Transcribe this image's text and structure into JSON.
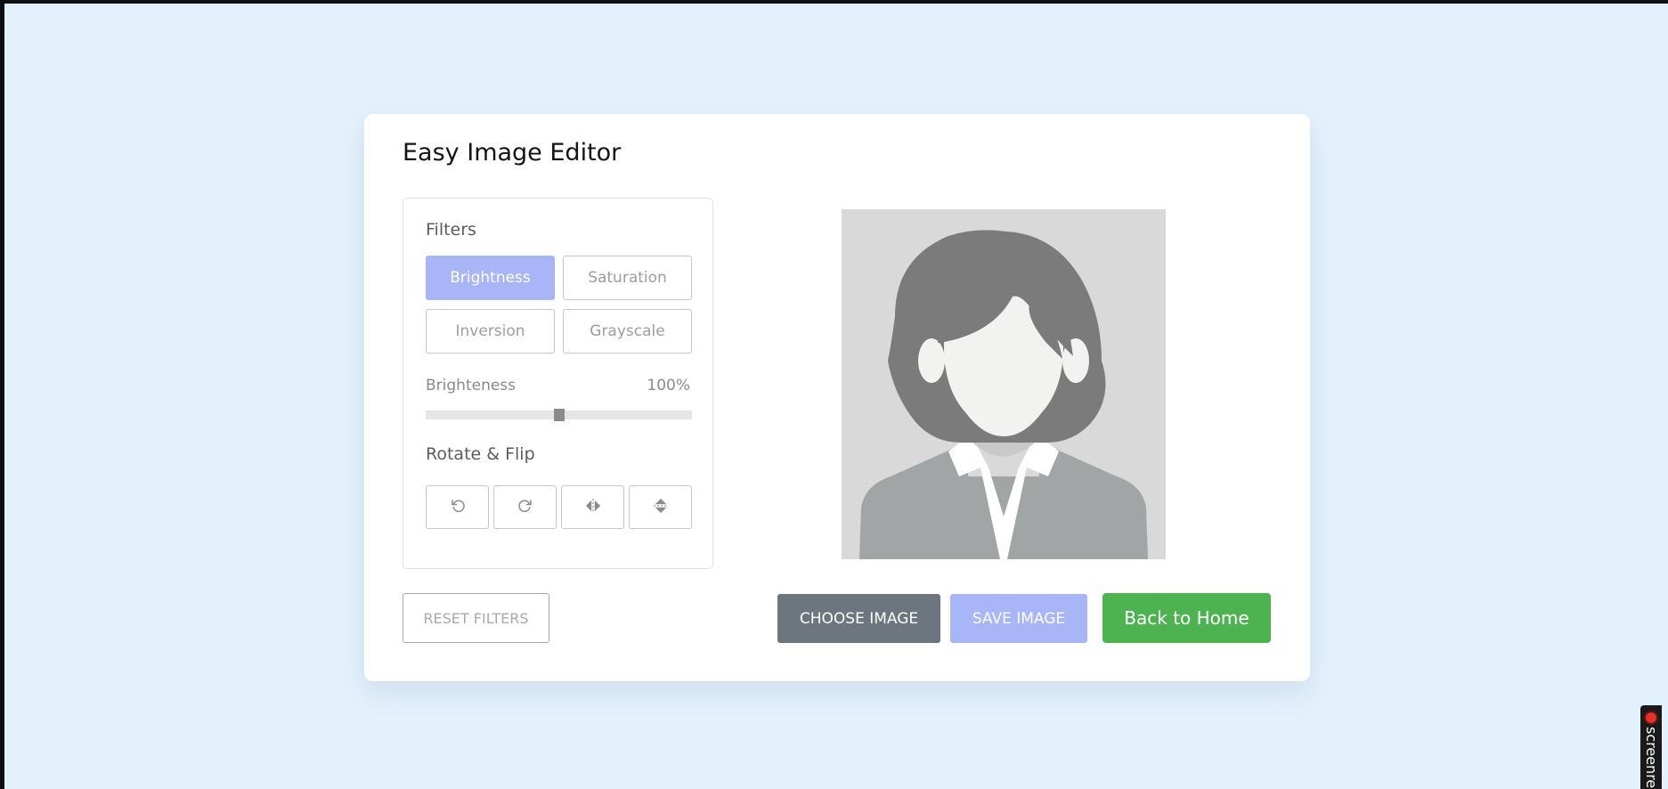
{
  "app": {
    "title": "Easy Image Editor"
  },
  "filters": {
    "heading": "Filters",
    "buttons": [
      {
        "label": "Brightness",
        "active": true
      },
      {
        "label": "Saturation",
        "active": false
      },
      {
        "label": "Inversion",
        "active": false
      },
      {
        "label": "Grayscale",
        "active": false
      }
    ]
  },
  "slider": {
    "label": "Brighteness",
    "value_text": "100%",
    "value": 100,
    "max": 200
  },
  "rotate": {
    "heading": "Rotate & Flip",
    "buttons": [
      {
        "icon": "rotate-left-icon"
      },
      {
        "icon": "rotate-right-icon"
      },
      {
        "icon": "flip-horizontal-icon"
      },
      {
        "icon": "flip-vertical-icon"
      }
    ]
  },
  "actions": {
    "reset": "RESET FILTERS",
    "choose": "CHOOSE IMAGE",
    "save": "SAVE IMAGE",
    "home": "Back to Home"
  },
  "recorder": {
    "text": "screenre"
  },
  "colors": {
    "background": "#e3f1fc",
    "accent": "#a8b5f6",
    "choose": "#6d757e",
    "home": "#4db351"
  }
}
